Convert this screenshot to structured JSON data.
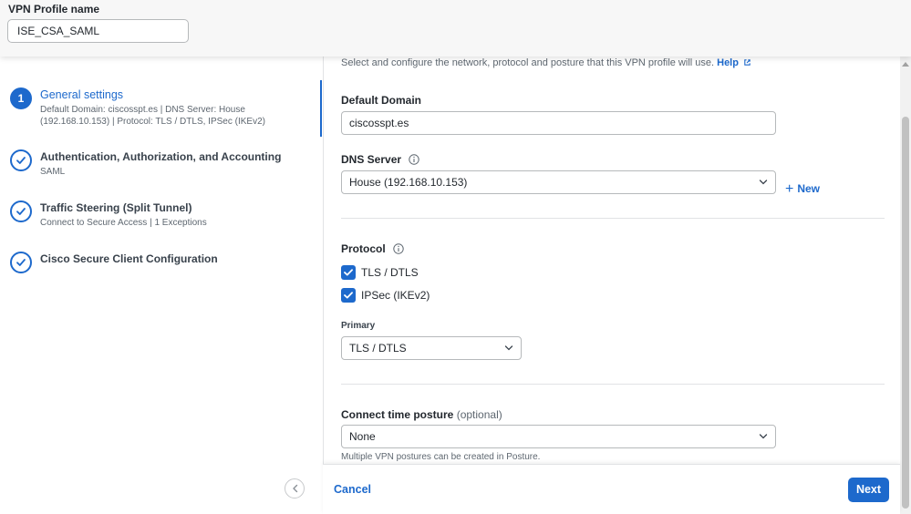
{
  "header": {
    "title": "VPN Profile name",
    "profile_name": "ISE_CSA_SAML"
  },
  "steps": [
    {
      "number": "1",
      "title": "General settings",
      "subtitle": "Default Domain: ciscosspt.es | DNS Server: House (192.168.10.153) | Protocol: TLS / DTLS, IPSec (IKEv2)",
      "state": "active"
    },
    {
      "title": "Authentication, Authorization, and Accounting",
      "subtitle": "SAML",
      "state": "done"
    },
    {
      "title": "Traffic Steering (Split Tunnel)",
      "subtitle": "Connect to Secure Access | 1 Exceptions",
      "state": "done"
    },
    {
      "title": "Cisco Secure Client Configuration",
      "subtitle": "",
      "state": "done"
    }
  ],
  "content": {
    "intro_text": "Select and configure the network, protocol and posture that this VPN profile will use.",
    "help_label": "Help",
    "default_domain": {
      "label": "Default Domain",
      "value": "ciscosspt.es"
    },
    "dns_server": {
      "label": "DNS Server",
      "value": "House (192.168.10.153)",
      "new_label": "New"
    },
    "protocol": {
      "label": "Protocol",
      "options": [
        {
          "label": "TLS / DTLS",
          "checked": true
        },
        {
          "label": "IPSec (IKEv2)",
          "checked": true
        }
      ],
      "primary_label": "Primary",
      "primary_value": "TLS / DTLS"
    },
    "posture": {
      "label": "Connect time posture",
      "optional": "(optional)",
      "value": "None",
      "hint": "Multiple VPN postures can be created in Posture."
    }
  },
  "footer": {
    "cancel_label": "Cancel",
    "next_label": "Next"
  },
  "colors": {
    "accent": "#1d69cc",
    "text": "#23282e",
    "muted": "#5e6770",
    "border": "#b6b9bb"
  }
}
